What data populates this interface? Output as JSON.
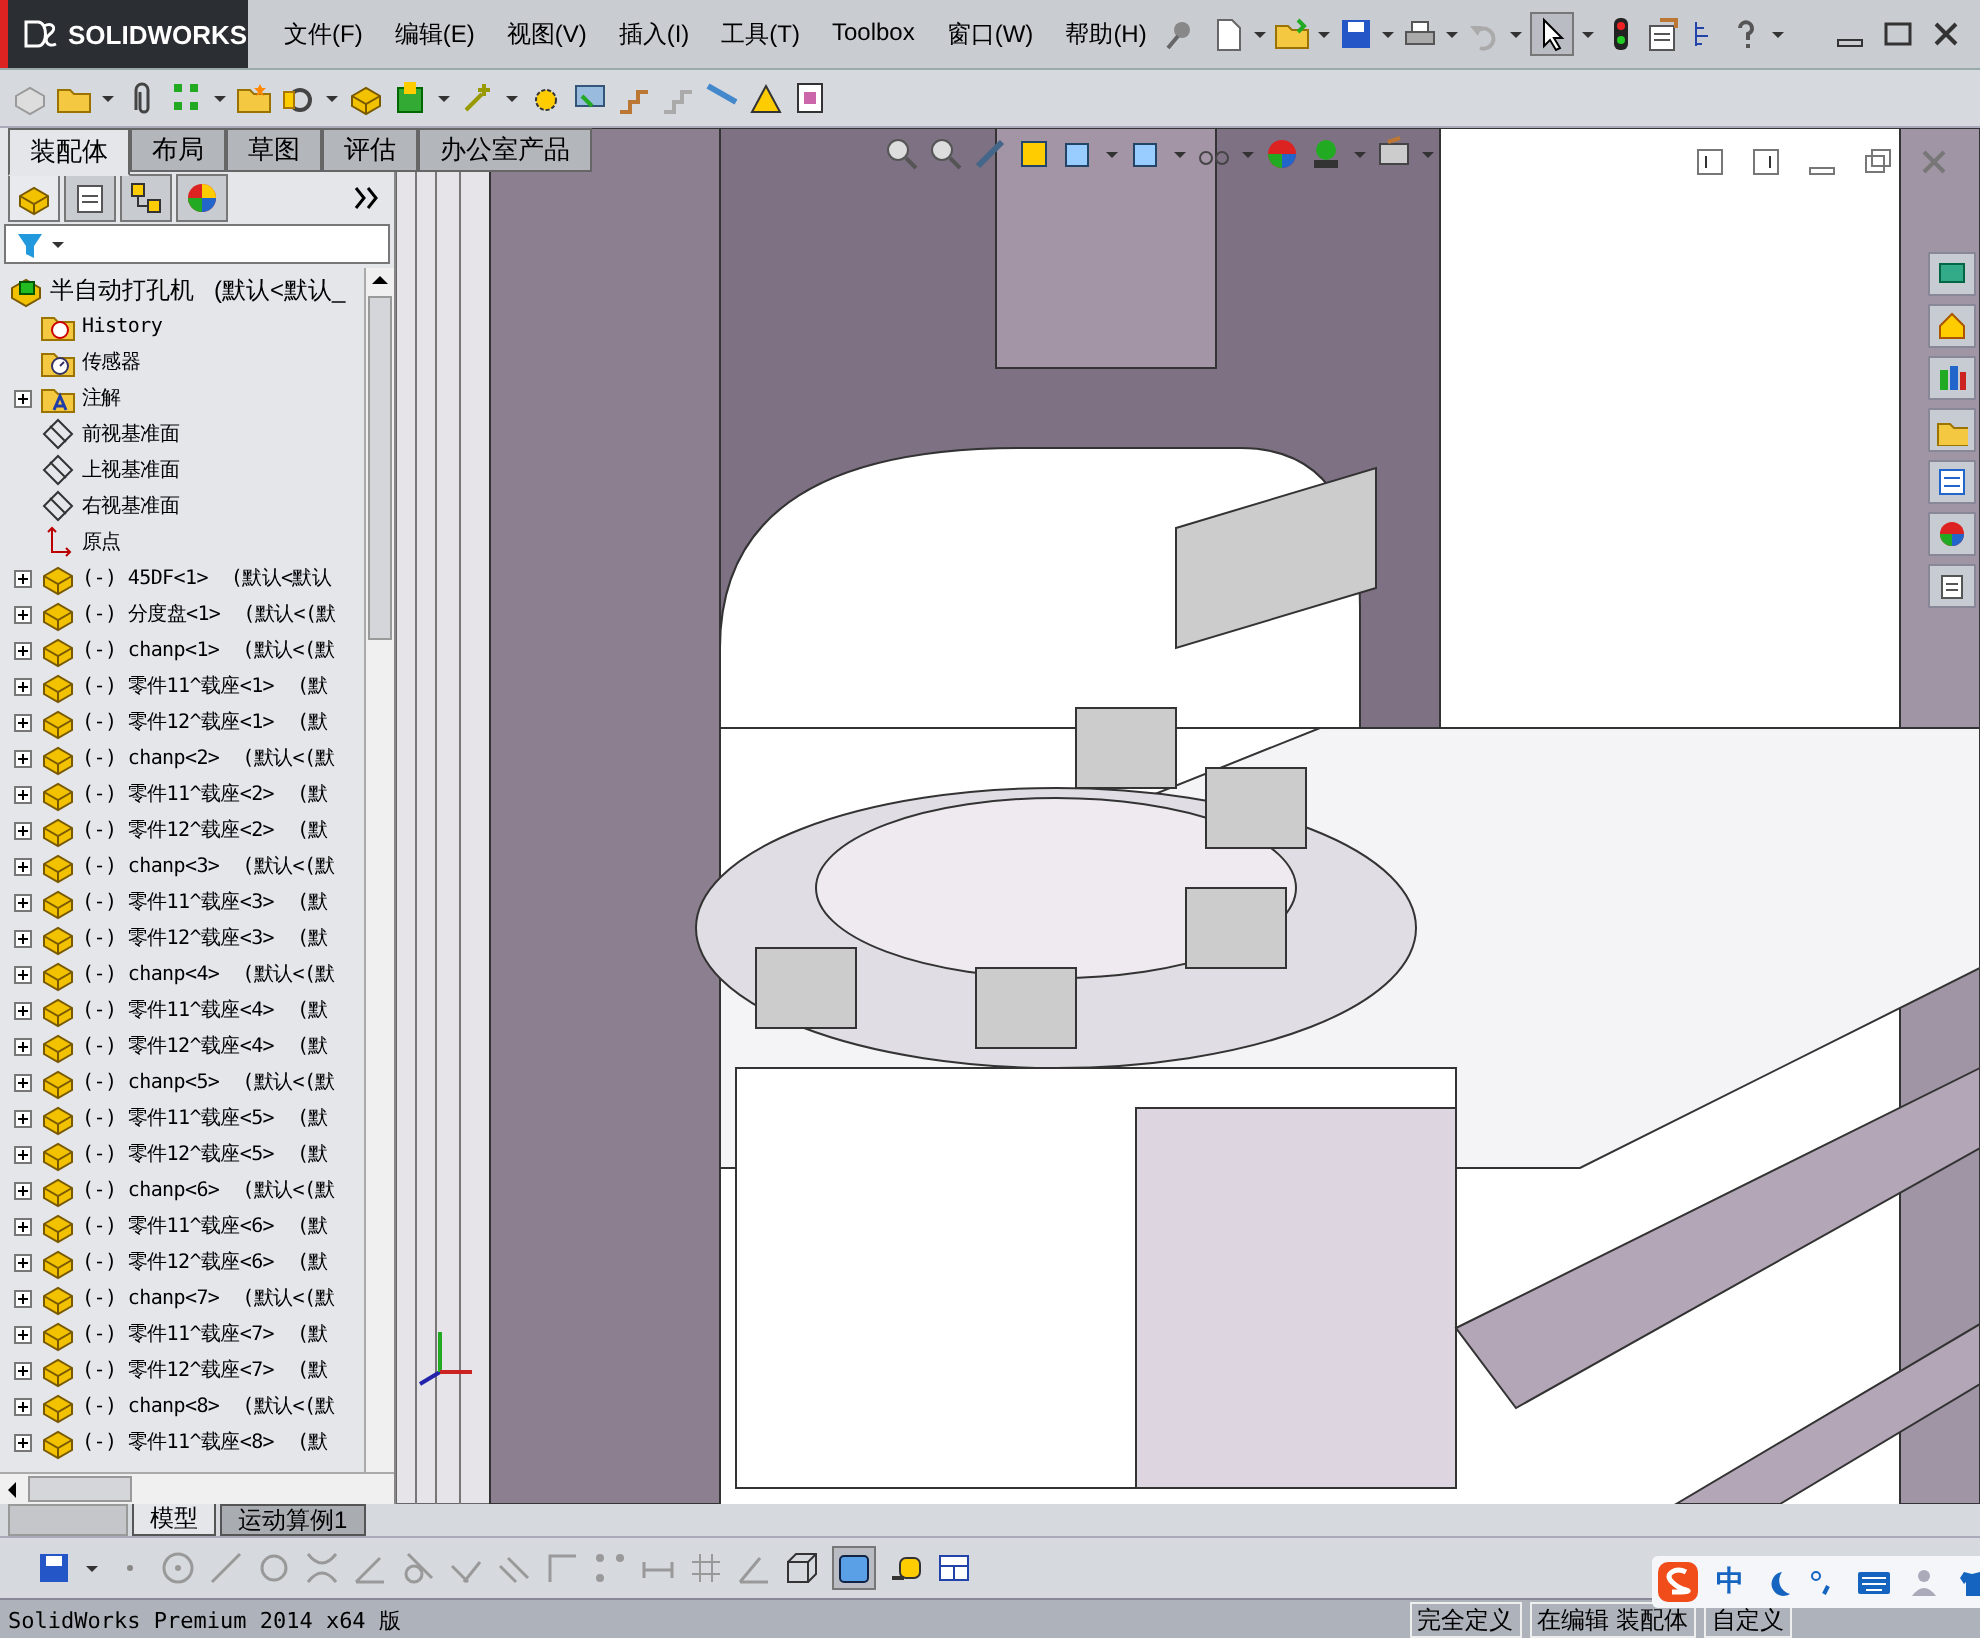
{
  "app": {
    "logo": "SOLIDWORKS",
    "menu": [
      "文件(F)",
      "编辑(E)",
      "视图(V)",
      "插入(I)",
      "工具(T)",
      "Toolbox",
      "窗口(W)",
      "帮助(H)"
    ]
  },
  "command_tabs": [
    {
      "label": "装配体",
      "selected": true
    },
    {
      "label": "布局",
      "selected": false
    },
    {
      "label": "草图",
      "selected": false
    },
    {
      "label": "评估",
      "selected": false
    },
    {
      "label": "办公室产品",
      "selected": false
    }
  ],
  "tree": {
    "label": "半自动打孔机",
    "config": "(默认<默认_",
    "children": [
      {
        "kind": "history",
        "label": "History",
        "expandable": false
      },
      {
        "kind": "sensor",
        "label": "传感器",
        "expandable": false
      },
      {
        "kind": "annotation",
        "label": "注解",
        "expandable": true
      },
      {
        "kind": "plane",
        "label": "前视基准面",
        "expandable": false
      },
      {
        "kind": "plane",
        "label": "上视基准面",
        "expandable": false
      },
      {
        "kind": "plane",
        "label": "右视基准面",
        "expandable": false
      },
      {
        "kind": "origin",
        "label": "原点",
        "expandable": false
      },
      {
        "kind": "component",
        "label": "(-) 45DF<1>",
        "config": "(默认<默认",
        "expandable": true
      },
      {
        "kind": "component",
        "label": "(-) 分度盘<1>",
        "config": "(默认<(默",
        "expandable": true
      },
      {
        "kind": "component",
        "label": "(-) chanp<1>",
        "config": "(默认<(默",
        "expandable": true
      },
      {
        "kind": "component",
        "label": "(-) 零件11^载座<1>",
        "config": "(默",
        "expandable": true
      },
      {
        "kind": "component",
        "label": "(-) 零件12^载座<1>",
        "config": "(默",
        "expandable": true
      },
      {
        "kind": "component",
        "label": "(-) chanp<2>",
        "config": "(默认<(默",
        "expandable": true
      },
      {
        "kind": "component",
        "label": "(-) 零件11^载座<2>",
        "config": "(默",
        "expandable": true
      },
      {
        "kind": "component",
        "label": "(-) 零件12^载座<2>",
        "config": "(默",
        "expandable": true
      },
      {
        "kind": "component",
        "label": "(-) chanp<3>",
        "config": "(默认<(默",
        "expandable": true
      },
      {
        "kind": "component",
        "label": "(-) 零件11^载座<3>",
        "config": "(默",
        "expandable": true
      },
      {
        "kind": "component",
        "label": "(-) 零件12^载座<3>",
        "config": "(默",
        "expandable": true
      },
      {
        "kind": "component",
        "label": "(-) chanp<4>",
        "config": "(默认<(默",
        "expandable": true
      },
      {
        "kind": "component",
        "label": "(-) 零件11^载座<4>",
        "config": "(默",
        "expandable": true
      },
      {
        "kind": "component",
        "label": "(-) 零件12^载座<4>",
        "config": "(默",
        "expandable": true
      },
      {
        "kind": "component",
        "label": "(-) chanp<5>",
        "config": "(默认<(默",
        "expandable": true
      },
      {
        "kind": "component",
        "label": "(-) 零件11^载座<5>",
        "config": "(默",
        "expandable": true
      },
      {
        "kind": "component",
        "label": "(-) 零件12^载座<5>",
        "config": "(默",
        "expandable": true
      },
      {
        "kind": "component",
        "label": "(-) chanp<6>",
        "config": "(默认<(默",
        "expandable": true
      },
      {
        "kind": "component",
        "label": "(-) 零件11^载座<6>",
        "config": "(默",
        "expandable": true
      },
      {
        "kind": "component",
        "label": "(-) 零件12^载座<6>",
        "config": "(默",
        "expandable": true
      },
      {
        "kind": "component",
        "label": "(-) chanp<7>",
        "config": "(默认<(默",
        "expandable": true
      },
      {
        "kind": "component",
        "label": "(-) 零件11^载座<7>",
        "config": "(默",
        "expandable": true
      },
      {
        "kind": "component",
        "label": "(-) 零件12^载座<7>",
        "config": "(默",
        "expandable": true
      },
      {
        "kind": "component",
        "label": "(-) chanp<8>",
        "config": "(默认<(默",
        "expandable": true
      },
      {
        "kind": "component",
        "label": "(-) 零件11^载座<8>",
        "config": "(默",
        "expandable": true
      }
    ]
  },
  "bottom_tabs": [
    {
      "label": "模型",
      "selected": true
    },
    {
      "label": "运动算例1",
      "selected": false
    }
  ],
  "status_bar": {
    "product": "SolidWorks Premium 2014 x64 版",
    "fields": [
      "完全定义",
      "在编辑 装配体",
      "自定义"
    ]
  },
  "ime_bar": {
    "mode": "中"
  }
}
